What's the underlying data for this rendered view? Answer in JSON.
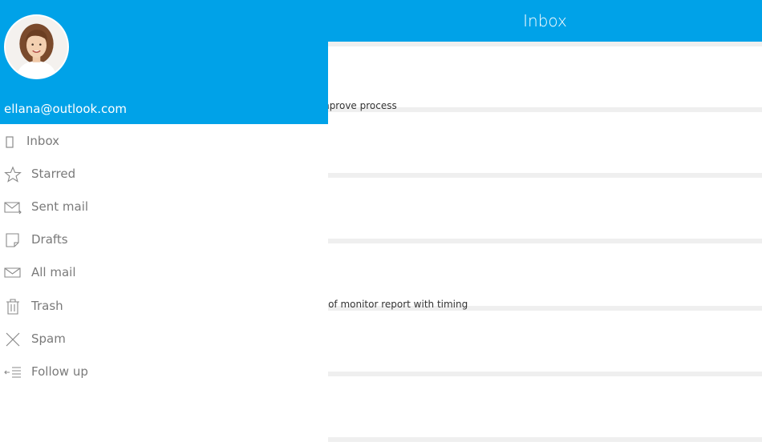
{
  "header": {
    "title": "Inbox"
  },
  "account": {
    "email": "ellana@outlook.com"
  },
  "nav": {
    "items": [
      {
        "label": "Inbox",
        "icon": "inbox-icon"
      },
      {
        "label": "Starred",
        "icon": "star-icon"
      },
      {
        "label": "Sent mail",
        "icon": "sent-mail-icon"
      },
      {
        "label": "Drafts",
        "icon": "drafts-icon"
      },
      {
        "label": "All mail",
        "icon": "envelope-icon"
      },
      {
        "label": "Trash",
        "icon": "trash-icon"
      },
      {
        "label": "Spam",
        "icon": "close-icon"
      },
      {
        "label": "Follow up",
        "icon": "follow-up-icon"
      }
    ]
  },
  "mail_list": {
    "items": [
      {
        "snippet": "mprove process"
      },
      {
        "snippet": ""
      },
      {
        "snippet": ""
      },
      {
        "snippet": "s of monitor report with timing"
      },
      {
        "snippet": ""
      },
      {
        "snippet": ""
      }
    ]
  },
  "colors": {
    "accent": "#00a2e8",
    "divider": "#efefef",
    "nav_text": "#7a7a7a"
  }
}
